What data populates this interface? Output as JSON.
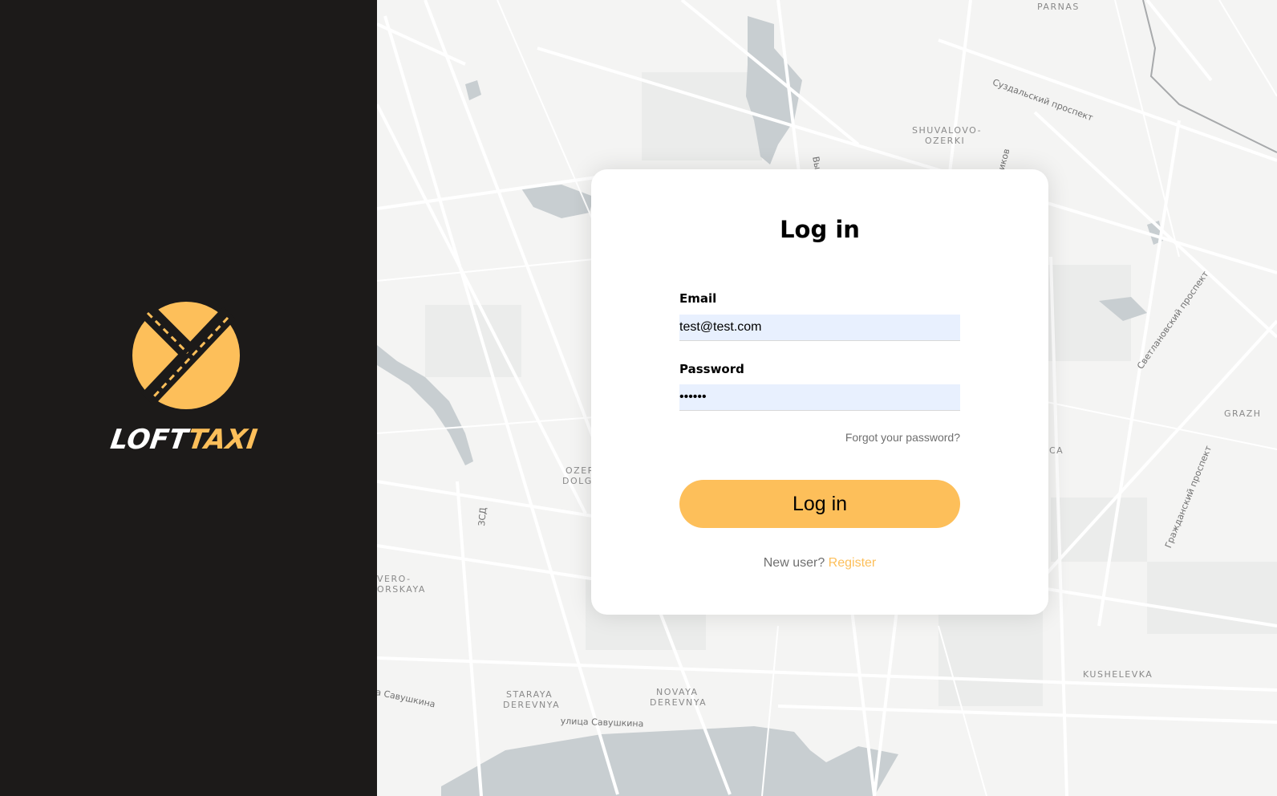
{
  "brand": {
    "name_part1": "LOFT",
    "name_part2": "TAXI",
    "accent_color": "#fdbf5a",
    "sidebar_color": "#1c1a19"
  },
  "map": {
    "labels": [
      {
        "id": "parnas",
        "text": "PARNAS"
      },
      {
        "id": "suzdalsky",
        "text": "Суздальский проспект"
      },
      {
        "id": "shuvalovo1",
        "text": "SHUVALOVO-"
      },
      {
        "id": "shuvalovo2",
        "text": "OZERKI"
      },
      {
        "id": "vyb",
        "text": "Выб"
      },
      {
        "id": "ikov",
        "text": "иков"
      },
      {
        "id": "svetlanovsky",
        "text": "Светлановский проспект"
      },
      {
        "id": "grazh",
        "text": "GRAZH"
      },
      {
        "id": "ca",
        "text": "CA"
      },
      {
        "id": "grazhdansky",
        "text": "Гражданский проспект"
      },
      {
        "id": "ozer1",
        "text": "OZER"
      },
      {
        "id": "ozer2",
        "text": "DOLGO"
      },
      {
        "id": "zsd",
        "text": "ЗСД"
      },
      {
        "id": "vero1",
        "text": "VERO-"
      },
      {
        "id": "vero2",
        "text": "ORSKAYA"
      },
      {
        "id": "kushelevka",
        "text": "KUSHELEVKA"
      },
      {
        "id": "savushkina1",
        "text": "а Савушкина"
      },
      {
        "id": "staraya1",
        "text": "STARAYA"
      },
      {
        "id": "staraya2",
        "text": "DEREVNYA"
      },
      {
        "id": "novaya1",
        "text": "NOVAYA"
      },
      {
        "id": "novaya2",
        "text": "DEREVNYA"
      },
      {
        "id": "savushkina2",
        "text": "улица Савушкина"
      }
    ]
  },
  "login": {
    "title": "Log in",
    "email_label": "Email",
    "email_value": "test@test.com",
    "password_label": "Password",
    "password_value": "••••••",
    "forgot_link": "Forgot your password?",
    "submit_label": "Log in",
    "new_user_text": "New user?",
    "register_link": "Register"
  }
}
